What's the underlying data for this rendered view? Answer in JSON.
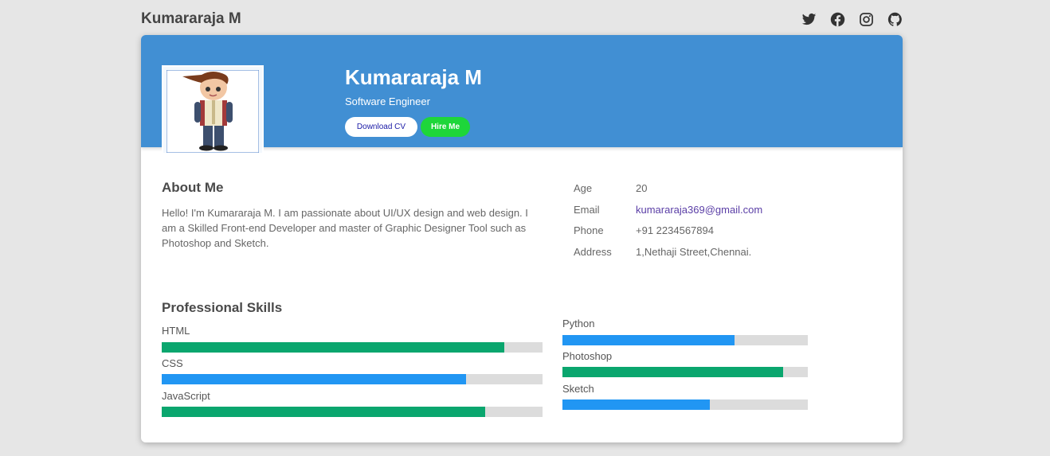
{
  "header": {
    "site_title": "Kumararaja M",
    "social": [
      "twitter-icon",
      "facebook-icon",
      "instagram-icon",
      "github-icon"
    ]
  },
  "profile": {
    "name": "Kumararaja M",
    "role": "Software Engineer",
    "download_label": "Download CV",
    "hire_label": "Hire Me"
  },
  "about": {
    "title": "About Me",
    "text": "Hello! I'm Kumararaja M. I am passionate about UI/UX design and web design. I am a Skilled Front-end Developer and master of Graphic Designer Tool such as Photoshop and Sketch."
  },
  "info": [
    {
      "label": "Age",
      "value": "20"
    },
    {
      "label": "Email",
      "value": "kumararaja369@gmail.com"
    },
    {
      "label": "Phone",
      "value": "+91 2234567894"
    },
    {
      "label": "Address",
      "value": "1,Nethaji Street,Chennai."
    }
  ],
  "skills": {
    "title": "Professional Skills",
    "items": [
      {
        "name": "HTML",
        "level": 0.9,
        "color": "#0aa66e"
      },
      {
        "name": "CSS",
        "level": 0.8,
        "color": "#2196f3"
      },
      {
        "name": "JavaScript",
        "level": 0.85,
        "color": "#0aa66e"
      },
      {
        "name": "Python",
        "level": 0.7,
        "color": "#2196f3"
      },
      {
        "name": "Photoshop",
        "level": 0.9,
        "color": "#0aa66e"
      },
      {
        "name": "Sketch",
        "level": 0.6,
        "color": "#2196f3"
      }
    ]
  },
  "colors": {
    "banner": "#418fd3",
    "hire_button": "#1ed63a",
    "skill_green": "#0aa66e",
    "skill_blue": "#2196f3"
  }
}
